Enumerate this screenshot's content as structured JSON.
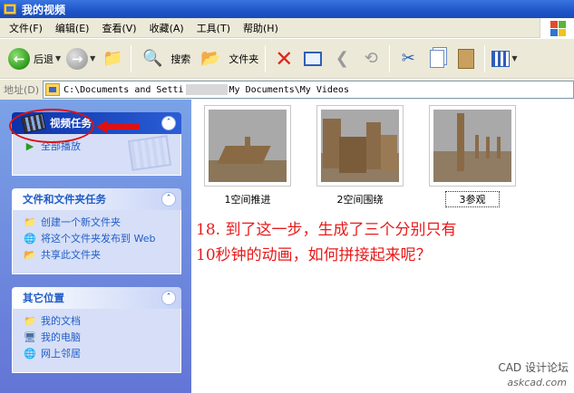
{
  "window": {
    "title": "我的视频"
  },
  "menu": [
    "文件(F)",
    "编辑(E)",
    "查看(V)",
    "收藏(A)",
    "工具(T)",
    "帮助(H)"
  ],
  "toolbar": {
    "back_label": "后退",
    "search_label": "搜索",
    "folders_label": "文件夹"
  },
  "address": {
    "label": "地址(D)",
    "path_start": "C:\\Documents and Setti",
    "path_end": "My Documents\\My Videos"
  },
  "tasks": {
    "video_title": "视频任务",
    "video_items": [
      "全部播放"
    ],
    "file_title": "文件和文件夹任务",
    "file_items": [
      "创建一个新文件夹",
      "将这个文件夹发布到 Web",
      "共享此文件夹"
    ],
    "other_title": "其它位置",
    "other_items": [
      "我的文档",
      "我的电脑",
      "网上邻居"
    ]
  },
  "files": [
    {
      "name": "1空间推进"
    },
    {
      "name": "2空间围绕"
    },
    {
      "name": "3参观",
      "selected": true
    }
  ],
  "annotation": {
    "line1": "18. 到了这一步，生成了三个分别只有",
    "line2": "10秒钟的动画，如何拼接起来呢？"
  },
  "watermark": {
    "text": "CAD 设计论坛",
    "site": "askcad.com"
  },
  "colors": {
    "title_bar": "#1e55c9",
    "task_pane": "#7ba2e7",
    "annotation_red": "#e81a1a"
  }
}
